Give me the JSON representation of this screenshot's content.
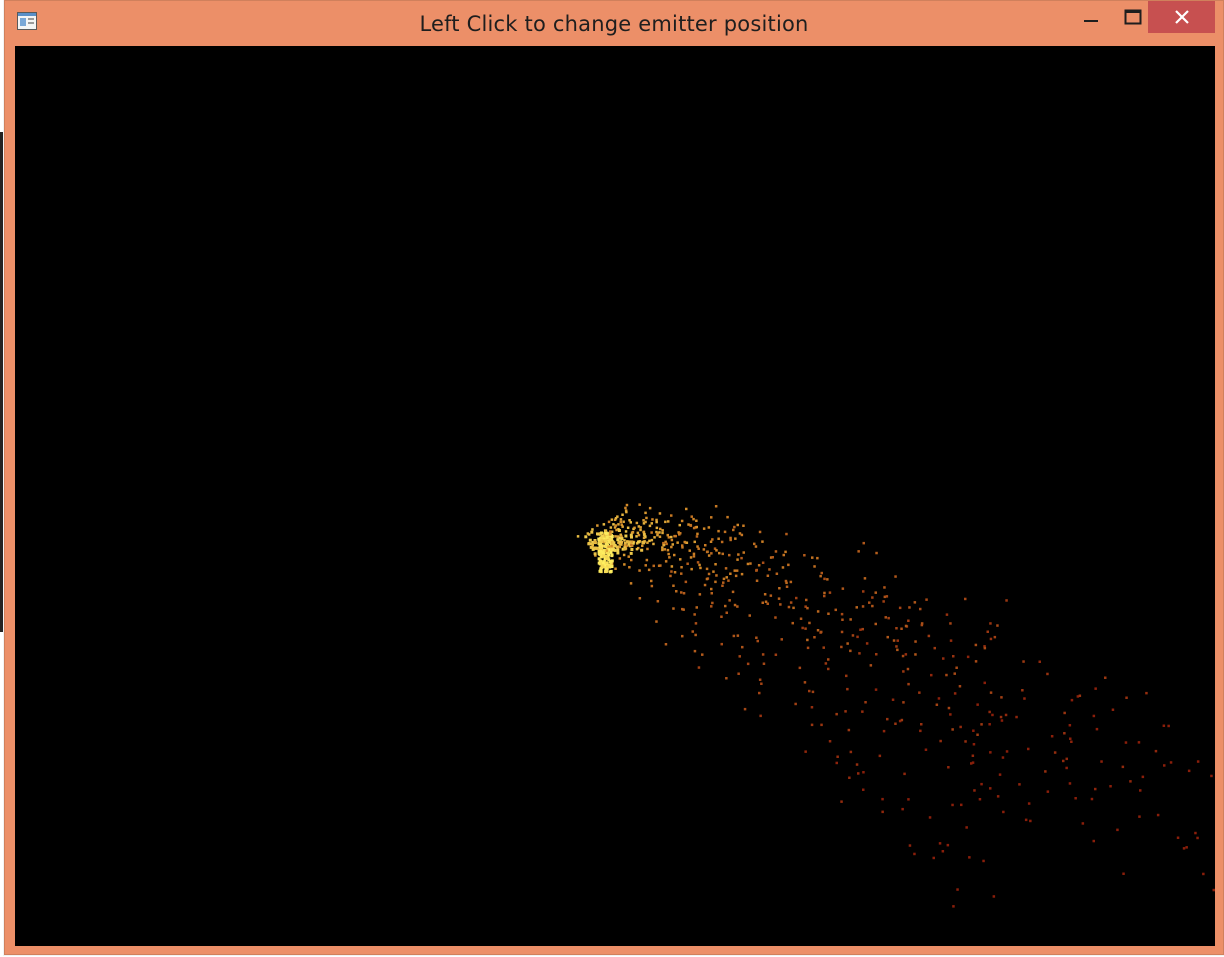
{
  "window": {
    "title": "Left Click to change emitter position",
    "frame_color": "#ec8f68",
    "close_button_color": "#c75050"
  },
  "controls": {
    "minimize_icon": "minimize-icon",
    "maximize_icon": "maximize-icon",
    "close_icon": "close-icon"
  },
  "canvas": {
    "background": "#000000",
    "emitter_color_near": "#fff060",
    "emitter_color_mid": "#d28a28",
    "emitter_color_far": "#8a1e0a"
  }
}
